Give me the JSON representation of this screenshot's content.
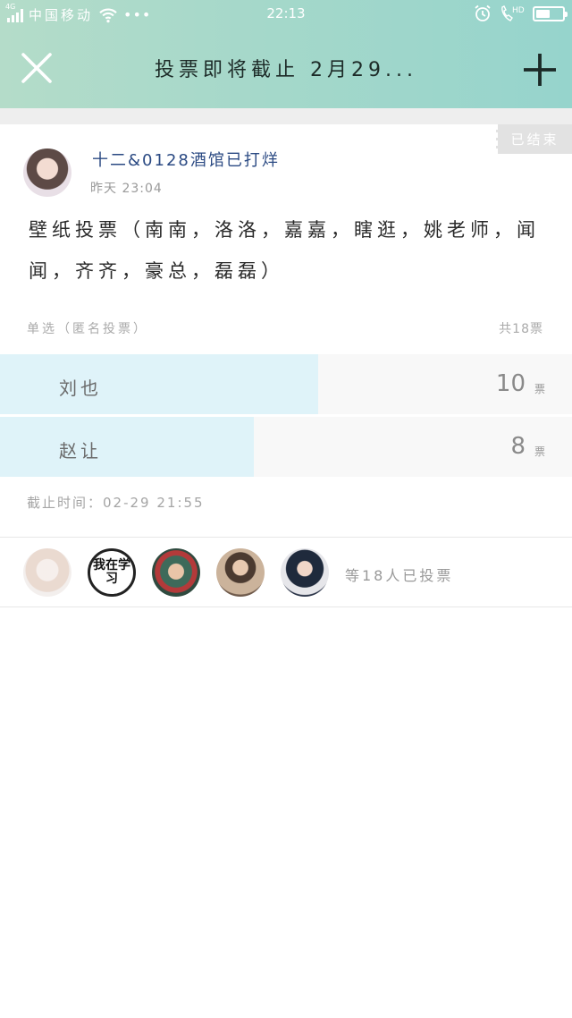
{
  "status_bar": {
    "network": "4G",
    "carrier": "中国移动",
    "more": "•••",
    "time": "22:13",
    "call_label": "HD",
    "battery_level": 0.55
  },
  "nav": {
    "title": "投票即将截止 2月29..."
  },
  "post": {
    "status_tag": "已结束",
    "author": "十二&0128酒馆已打烊",
    "time": "昨天 23:04",
    "text": "壁纸投票（南南，洛洛，嘉嘉，瞎逛，姚老师，闻闻，齐齐，豪总，磊磊）"
  },
  "poll": {
    "mode": "单选（匿名投票）",
    "total": "共18票",
    "options": [
      {
        "label": "刘也",
        "votes": "10",
        "unit": "票",
        "fraction": 0.5556
      },
      {
        "label": "赵让",
        "votes": "8",
        "unit": "票",
        "fraction": 0.4444
      }
    ],
    "deadline": "截止时间：02-29 21:55"
  },
  "voters": {
    "avatar_badge_text": "我在学习",
    "summary": "等18人已投票"
  }
}
